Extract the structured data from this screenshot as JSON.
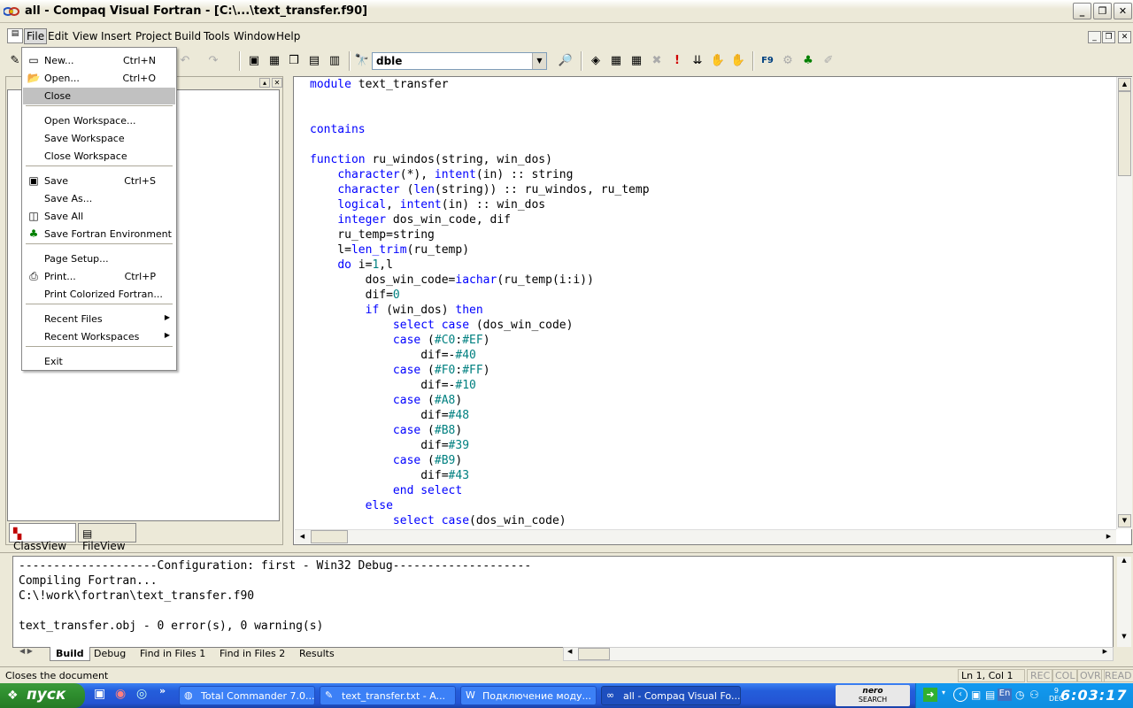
{
  "window": {
    "title": "all - Compaq Visual Fortran - [C:\\...\\text_transfer.f90]"
  },
  "menubar": [
    "File",
    "Edit",
    "View",
    "Insert",
    "Project",
    "Build",
    "Tools",
    "Window",
    "Help"
  ],
  "toolbar": {
    "combo_value": "dble"
  },
  "file_menu": {
    "items": [
      {
        "label": "New...",
        "shortcut": "Ctrl+N",
        "icon": "new-icon"
      },
      {
        "label": "Open...",
        "shortcut": "Ctrl+O",
        "icon": "open-folder-icon"
      },
      {
        "label": "Close",
        "shortcut": "",
        "icon": ""
      },
      {
        "label": "Open Workspace...",
        "shortcut": "",
        "icon": ""
      },
      {
        "label": "Save Workspace",
        "shortcut": "",
        "icon": ""
      },
      {
        "label": "Close Workspace",
        "shortcut": "",
        "icon": ""
      },
      {
        "label": "Save",
        "shortcut": "Ctrl+S",
        "icon": "save-icon"
      },
      {
        "label": "Save As...",
        "shortcut": "",
        "icon": ""
      },
      {
        "label": "Save All",
        "shortcut": "",
        "icon": "save-all-icon"
      },
      {
        "label": "Save Fortran Environment",
        "shortcut": "",
        "icon": "tree-icon"
      },
      {
        "label": "Page Setup...",
        "shortcut": "",
        "icon": ""
      },
      {
        "label": "Print...",
        "shortcut": "Ctrl+P",
        "icon": "printer-icon"
      },
      {
        "label": "Print Colorized Fortran...",
        "shortcut": "",
        "icon": ""
      },
      {
        "label": "Recent Files",
        "shortcut": "",
        "icon": ""
      },
      {
        "label": "Recent Workspaces",
        "shortcut": "",
        "icon": ""
      },
      {
        "label": "Exit",
        "shortcut": "",
        "icon": ""
      }
    ]
  },
  "workspace": {
    "tabs": [
      "ClassView",
      "FileView"
    ]
  },
  "editor": {
    "lines": [
      "module text_transfer",
      "",
      "",
      "contains",
      "",
      "function ru_windos(string, win_dos)",
      "    character(*), intent(in) :: string",
      "    character (len(string)) :: ru_windos, ru_temp",
      "    logical, intent(in) :: win_dos",
      "    integer dos_win_code, dif",
      "    ru_temp=string",
      "    l=len_trim(ru_temp)",
      "    do i=1,l",
      "        dos_win_code=iachar(ru_temp(i:i))",
      "        dif=0",
      "        if (win_dos) then",
      "            select case (dos_win_code)",
      "            case (#C0:#EF)",
      "                dif=-#40",
      "            case (#F0:#FF)",
      "                dif=-#10",
      "            case (#A8)",
      "                dif=#48",
      "            case (#B8)",
      "                dif=#39",
      "            case (#B9)",
      "                dif=#43",
      "            end select",
      "        else",
      "            select case(dos_win_code)"
    ]
  },
  "output": {
    "lines": [
      "--------------------Configuration: first - Win32 Debug--------------------",
      "Compiling Fortran...",
      "C:\\!work\\fortran\\text_transfer.f90",
      "",
      "text_transfer.obj - 0 error(s), 0 warning(s)"
    ],
    "tabs": [
      "Build",
      "Debug",
      "Find in Files 1",
      "Find in Files 2",
      "Results"
    ]
  },
  "statusbar": {
    "message": "Closes the document",
    "position": "Ln 1, Col 1",
    "indicators": [
      "REC",
      "COL",
      "OVR",
      "READ"
    ]
  },
  "taskbar": {
    "start_label": "пуск",
    "tasks": [
      "Total Commander 7.0...",
      "text_transfer.txt - A...",
      "Подключение моду...",
      "all - Compaq Visual Fo..."
    ],
    "tray_brand": "nero",
    "tray_sub": "SEARCH",
    "lang": "En",
    "date_day": "9",
    "date_month": "DEC",
    "clock": "6:03:17"
  }
}
